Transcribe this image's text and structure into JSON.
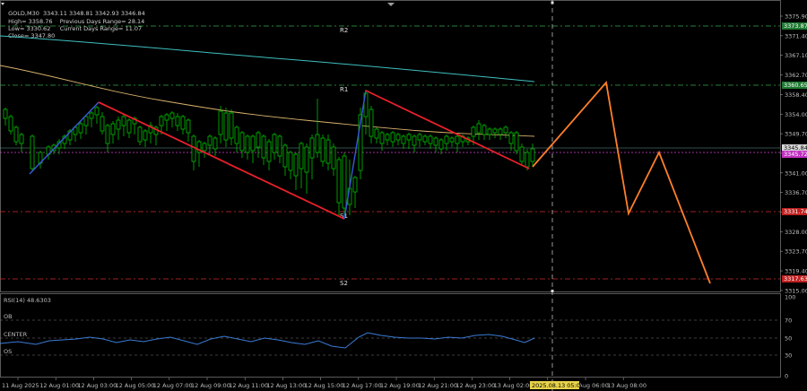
{
  "header": {
    "symbol": "GOLD,M30",
    "ohlc": "3343.11 3348.81 3342.93 3346.84",
    "high_label": "High= 3358.76",
    "prev_range_label": "Previous Days Range= 28.14",
    "low_label": "Low= 3330.62",
    "cur_range_label": "Current Days Range= 11.07",
    "close_label": "Close= 3347.80"
  },
  "levels": {
    "r2": "R2",
    "r1": "R1",
    "s1": "S1",
    "s2": "S2"
  },
  "price_axis": {
    "ticks": [
      "3375.90",
      "3371.40",
      "3367.10",
      "3362.70",
      "3358.40",
      "3354.00",
      "3349.70",
      "3345.30",
      "3341.00",
      "3336.70",
      "3332.30",
      "3328.00",
      "3323.70",
      "3319.40",
      "3315.00"
    ],
    "tag_r2": "3373.87",
    "tag_r1": "3360.65",
    "tag_current": "3345.84",
    "tag_close": "3345.72",
    "tag_s1": "3331.74",
    "tag_s2": "3317.63"
  },
  "rsi": {
    "label": "RSI(14) 48.6303",
    "ob": "OB",
    "center": "CENTER",
    "os": "OS",
    "ticks": [
      "100",
      "70",
      "50",
      "30",
      "0"
    ]
  },
  "time_axis": {
    "labels": [
      "11 Aug 2025",
      "12 Aug 01:00",
      "12 Aug 03:00",
      "12 Aug 05:00",
      "12 Aug 07:00",
      "12 Aug 09:00",
      "12 Aug 11:00",
      "12 Aug 13:00",
      "12 Aug 15:00",
      "12 Aug 17:00",
      "12 Aug 19:00",
      "12 Aug 21:00",
      "12 Aug 23:00",
      "13 Aug 02:00",
      "13 Aug 04:00",
      "13 Aug 06:00",
      "13 Aug 08:00"
    ],
    "highlight": "2025.08.13 05:00"
  },
  "colors": {
    "background": "#000000",
    "bull": "#ffffff",
    "bear": "#ffffff",
    "wick": "#00c000",
    "ma_fast": "#d9b36c",
    "ma_slow": "#3fbfc0",
    "trend_red": "#e8202a",
    "trend_blue": "#3a5bd9",
    "projection": "#ff7f2a",
    "rsi_line": "#3a7bd5"
  }
}
